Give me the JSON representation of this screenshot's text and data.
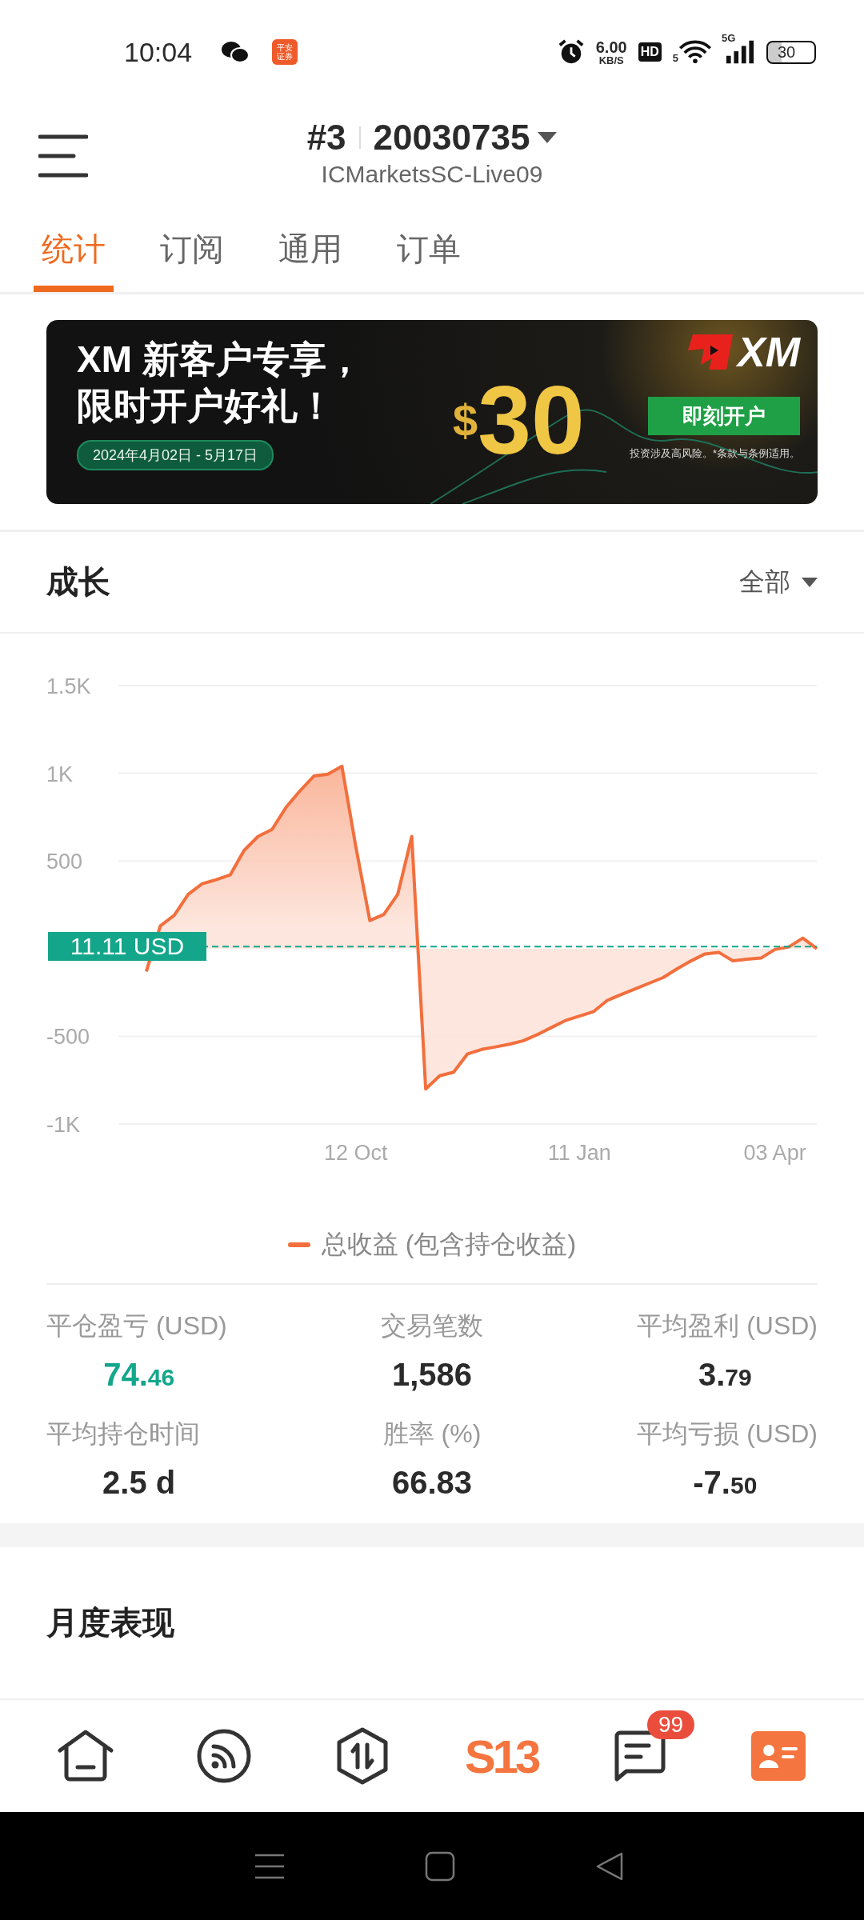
{
  "status_bar": {
    "time": "10:04",
    "app_badge": "平安证券",
    "speed": "6.00",
    "speed_unit": "KB/S",
    "hd": "HD",
    "wifi_label": "5",
    "network": "5G",
    "battery": "30"
  },
  "header": {
    "account_index": "#3",
    "account_number": "20030735",
    "server": "ICMarketsSC-Live09"
  },
  "tabs": [
    {
      "label": "统计",
      "selected": true
    },
    {
      "label": "订阅",
      "selected": false
    },
    {
      "label": "通用",
      "selected": false
    },
    {
      "label": "订单",
      "selected": false
    }
  ],
  "banner": {
    "headline": [
      "XM 新客户专享，",
      "限时开户好礼！"
    ],
    "dates": "2024年4月02日 - 5月17日",
    "currency": "$",
    "amount": "30",
    "logo": "XM",
    "button": "即刻开户",
    "disclaimer": "投资涉及高风险。*条款与条例适用。"
  },
  "growth": {
    "title": "成长",
    "filter": "全部",
    "chart_data": {
      "type": "area",
      "grid": true,
      "ylim": [
        -1000,
        1500
      ],
      "categories": [
        null,
        null,
        null,
        null,
        null,
        null,
        null,
        null,
        null,
        null,
        null,
        null,
        null,
        null,
        null,
        null,
        null,
        "12 Oct",
        null,
        null,
        null,
        null,
        null,
        null,
        null,
        null,
        null,
        null,
        null,
        null,
        null,
        null,
        null,
        "11 Jan",
        null,
        null,
        null,
        null,
        null,
        null,
        null,
        null,
        null,
        null,
        null,
        null,
        null,
        "03 Apr",
        null,
        null,
        null
      ],
      "series": [
        {
          "name": "总收益 (包含持仓收益)",
          "color": "#f26f3d",
          "values": [
            null,
            null,
            -130,
            130,
            190,
            310,
            370,
            393,
            420,
            560,
            640,
            680,
            805,
            900,
            984,
            995,
            1040,
            580,
            160,
            195,
            310,
            640,
            -800,
            -725,
            -705,
            -600,
            -575,
            -560,
            -545,
            -525,
            -490,
            -450,
            -410,
            -385,
            -360,
            -295,
            -262,
            -230,
            -197,
            -165,
            -115,
            -70,
            -30,
            -22,
            -70,
            -60,
            -54,
            -5,
            10,
            60,
            0
          ]
        }
      ],
      "yticks": [
        {
          "value": 1500,
          "label": "1.5K"
        },
        {
          "value": 1000,
          "label": "1K"
        },
        {
          "value": 500,
          "label": "500"
        },
        {
          "value": -500,
          "label": "-500"
        },
        {
          "value": -1000,
          "label": "-1K"
        }
      ],
      "ref_lines": [
        {
          "axis": "y",
          "value": 11.11,
          "label": "11.11 USD",
          "color": "#13a68b"
        }
      ]
    }
  },
  "stats": [
    {
      "label": "平仓盈亏 (USD)",
      "value": "74.",
      "fraction": "46",
      "color": "#13a68b"
    },
    {
      "label": "交易笔数",
      "value": "1,586",
      "color": "#2b2b2b"
    },
    {
      "label": "平均盈利 (USD)",
      "value": "3.",
      "fraction": "79",
      "color": "#2b2b2b"
    },
    {
      "label": "平均持仓时间",
      "value": "2.5 d",
      "color": "#2b2b2b"
    },
    {
      "label": "胜率 (%)",
      "value": "66.83",
      "color": "#2b2b2b"
    },
    {
      "label": "平均亏损 (USD)",
      "value": "-7.",
      "fraction": "50",
      "color": "#2b2b2b"
    }
  ],
  "monthly": {
    "title": "月度表现"
  },
  "bottom_nav": [
    {
      "kind": "home",
      "selected": false
    },
    {
      "kind": "feed",
      "selected": false
    },
    {
      "kind": "trade",
      "selected": false
    },
    {
      "kind": "logo",
      "label": "S13",
      "selected": false
    },
    {
      "kind": "messages",
      "badge": "99",
      "selected": false
    },
    {
      "kind": "profile",
      "selected": true
    }
  ]
}
